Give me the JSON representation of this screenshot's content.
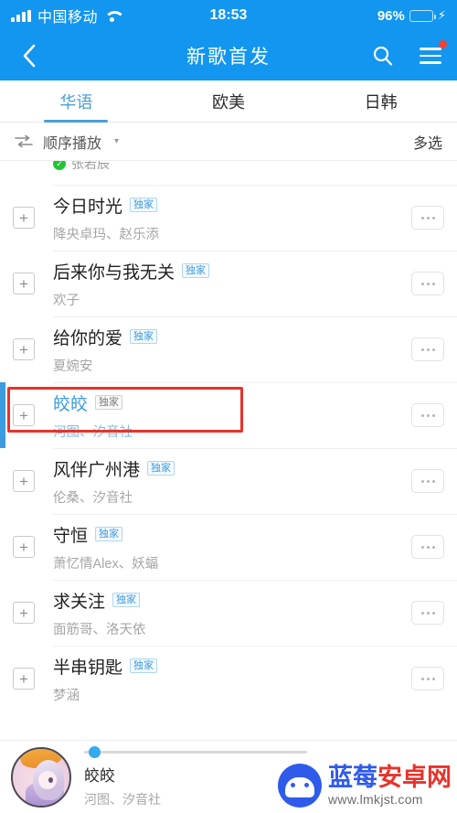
{
  "status_bar": {
    "carrier": "中国移动",
    "signal_icon": "signal-bars-icon",
    "wifi_icon": "wifi-icon",
    "time": "18:53",
    "battery_percent": "96%",
    "battery_level": 96,
    "charging_icon": "lightning-bolt-icon"
  },
  "nav_bar": {
    "back_icon": "chevron-left-icon",
    "title": "新歌首发",
    "search_icon": "search-icon",
    "menu_icon": "hamburger-menu-icon",
    "has_notification_dot": true,
    "background_color": "#1296f0"
  },
  "tabs": {
    "active_index": 0,
    "items": [
      {
        "label": "华语"
      },
      {
        "label": "欧美"
      },
      {
        "label": "日韩"
      }
    ],
    "active_color": "#4a9fd8"
  },
  "control_row": {
    "order_icon": "sequential-play-icon",
    "order_label": "顺序播放",
    "caret_icon": "chevron-down-icon",
    "multi_select_label": "多选"
  },
  "partial_row": {
    "verified_icon": "verified-check-icon",
    "artist": "张若辰"
  },
  "list": {
    "add_icon": "plus-icon",
    "more_icon": "ellipsis-icon",
    "badge_label": "独家",
    "songs": [
      {
        "title": "今日时光",
        "artist": "降央卓玛、赵乐添",
        "badge": "独家",
        "playing": false
      },
      {
        "title": "后来你与我无关",
        "artist": "欢子",
        "badge": "独家",
        "playing": false
      },
      {
        "title": "给你的爱",
        "artist": "夏婉安",
        "badge": "独家",
        "playing": false
      },
      {
        "title": "皎皎",
        "artist": "河图、汐音社",
        "badge": "独家",
        "playing": true
      },
      {
        "title": "风伴广州港",
        "artist": "伦桑、汐音社",
        "badge": "独家",
        "playing": false
      },
      {
        "title": "守恒",
        "artist": "萧忆情Alex、妖蝠",
        "badge": "独家",
        "playing": false
      },
      {
        "title": "求关注",
        "artist": "面筋哥、洛天依",
        "badge": "独家",
        "playing": false
      },
      {
        "title": "半串钥匙",
        "artist": "梦涵",
        "badge": "独家",
        "playing": false
      }
    ]
  },
  "annotation": {
    "color": "#e8332a",
    "target_song": "皎皎"
  },
  "player": {
    "album_art": "album-art-thumbnail",
    "title": "皎皎",
    "artist": "河图、汐音社",
    "progress_percent": 2
  },
  "watermark": {
    "logo_icon": "android-robot-logo-icon",
    "name_part1": "蓝莓",
    "name_part2": "安卓网",
    "url": "www.lmkjst.com"
  }
}
